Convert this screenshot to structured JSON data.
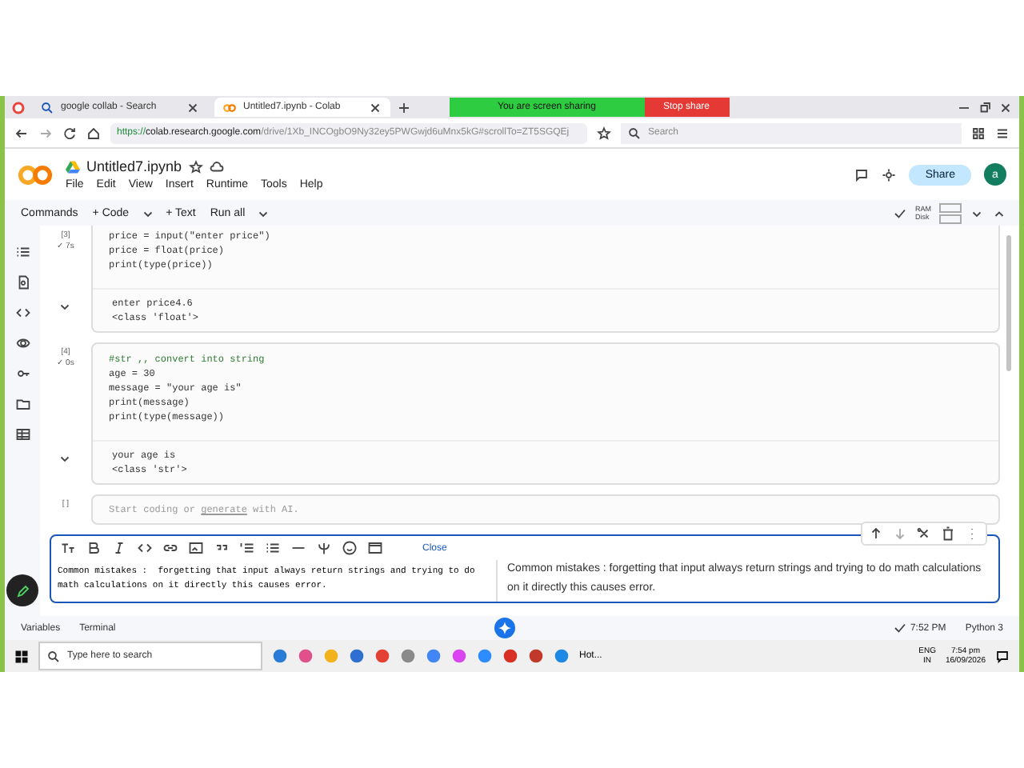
{
  "browser": {
    "tabs": [
      {
        "label": "google collab - Search",
        "selected": false
      },
      {
        "label": "Untitled7.ipynb - Colab",
        "selected": true
      }
    ],
    "share_banner": {
      "message": "You are screen sharing",
      "stop": "Stop share"
    },
    "url": {
      "secure": "https://",
      "host": "colab.research.google.com",
      "path": "/drive/1Xb_INCOgbO9Ny32ey5PWGwjd6uMnx5kG#scrollTo=ZT5SGQEj"
    },
    "search": {
      "placeholder": "Search"
    }
  },
  "notebook": {
    "title": "Untitled7.ipynb",
    "menus": [
      "File",
      "Edit",
      "View",
      "Insert",
      "Runtime",
      "Tools",
      "Help"
    ],
    "share": "Share",
    "avatar": "a"
  },
  "toolbar": {
    "commands": "Commands",
    "add_code": "+ Code",
    "add_text": "+ Text",
    "run_all": "Run all",
    "ram": "RAM",
    "disk": "Disk"
  },
  "cells": [
    {
      "kind": "code",
      "count": "[3]",
      "status": "✓ 7s",
      "lines": [
        {
          "text": "price = input(\"enter price\")",
          "comment": false
        },
        {
          "text": "price = float(price)",
          "comment": false
        },
        {
          "text": "print(type(price))",
          "comment": false
        }
      ],
      "output": [
        "enter price4.6",
        "<class 'float'>"
      ]
    },
    {
      "kind": "code",
      "count": "[4]",
      "status": "✓ 0s",
      "lines": [
        {
          "text": "#str ,, convert into string",
          "comment": true
        },
        {
          "text": "age = 30",
          "comment": false
        },
        {
          "text": "message = \"your age is\"",
          "comment": false
        },
        {
          "text": "print(message)",
          "comment": false
        },
        {
          "text": "print(type(message))",
          "comment": false
        }
      ],
      "output": [
        "your age is",
        "<class 'str'>"
      ]
    },
    {
      "kind": "empty",
      "count": "[ ]",
      "placeholder_before": "Start coding or ",
      "link": "generate",
      "placeholder_after": " with AI."
    },
    {
      "kind": "text",
      "close": "Close",
      "source": "Common mistakes :  forgetting that input always return strings and trying to do math calculations on it directly this causes error.",
      "rendered": "Common mistakes : forgetting that input always return strings and trying to do math calculations on it directly this causes error."
    }
  ],
  "status_bar": {
    "variables": "Variables",
    "terminal": "Terminal",
    "time": "7:52 PM",
    "runtime": "Python 3"
  },
  "taskbar": {
    "search_placeholder": "Type here to search",
    "app_label": "Hot...",
    "lang": "ENG",
    "region": "IN",
    "clock": "7:54 pm",
    "date": "16/09/2026"
  }
}
